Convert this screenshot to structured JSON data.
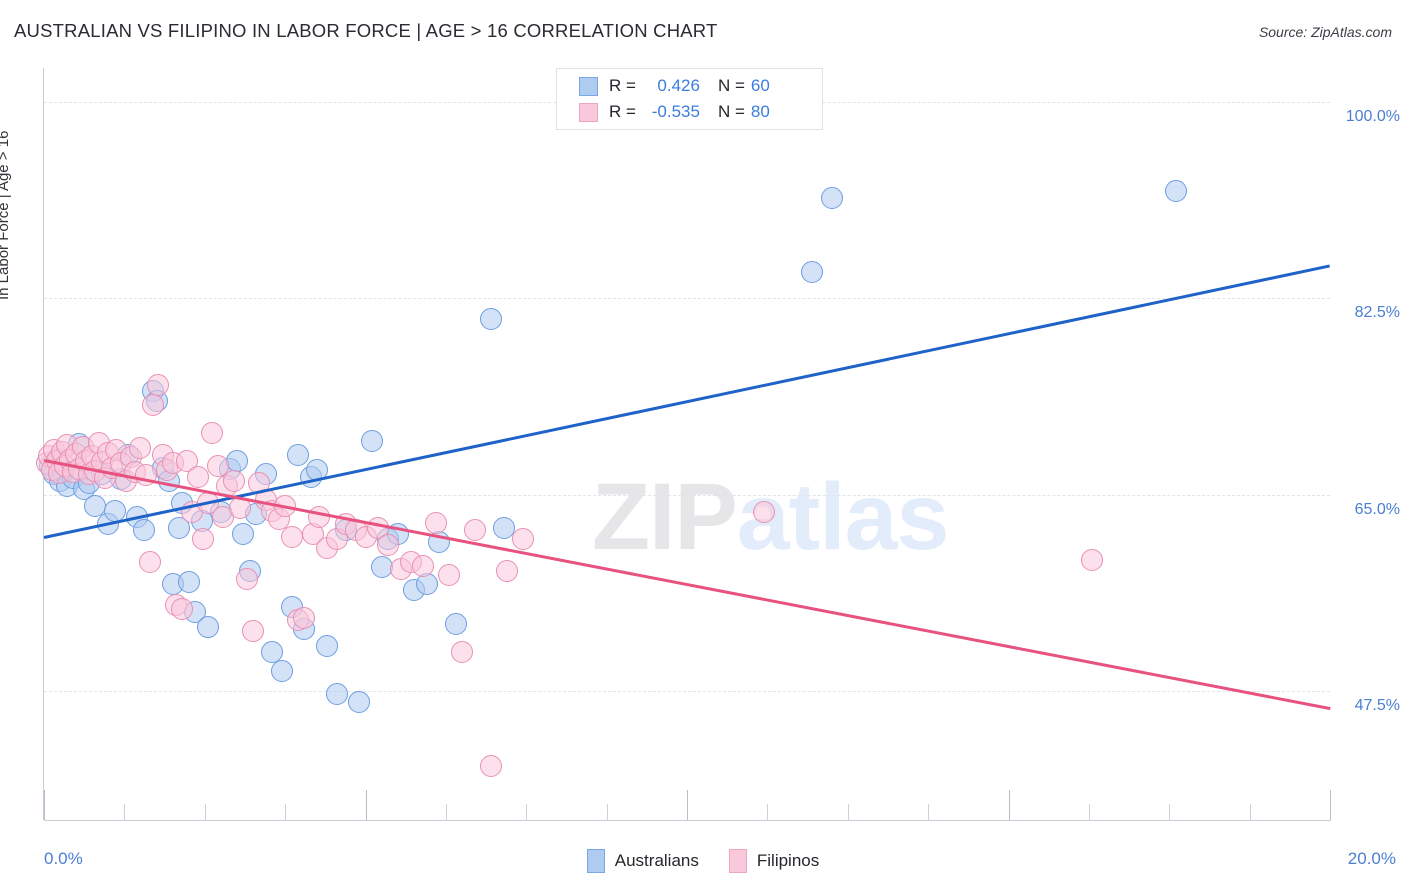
{
  "header": {
    "title": "AUSTRALIAN VS FILIPINO IN LABOR FORCE | AGE > 16 CORRELATION CHART",
    "source": "Source: ZipAtlas.com"
  },
  "watermark": {
    "zip": "ZIP",
    "atlas": "atlas"
  },
  "stats": {
    "rows": [
      {
        "series": "Australians",
        "r_label": "R =",
        "r_value": "0.426",
        "n_label": "N =",
        "n_value": "60",
        "color": "#aecbf0"
      },
      {
        "series": "Filipinos",
        "r_label": "R =",
        "r_value": "-0.535",
        "n_label": "N =",
        "n_value": "80",
        "color": "#f9c8da"
      }
    ]
  },
  "legend": {
    "items": [
      {
        "label": "Australians",
        "color": "#aecbf0",
        "border": "#7ba7e8"
      },
      {
        "label": "Filipinos",
        "color": "#f9c8da",
        "border": "#eda5c2"
      }
    ]
  },
  "chart_data": {
    "type": "scatter",
    "title": "AUSTRALIAN VS FILIPINO IN LABOR FORCE | AGE > 16 CORRELATION CHART",
    "xlabel": "",
    "ylabel": "In Labor Force | Age > 16",
    "xlim": [
      0.0,
      20.0
    ],
    "ylim": [
      36.0,
      103.0
    ],
    "x_ticklabels": [
      "0.0%",
      "20.0%"
    ],
    "y_ticklabels": [
      "100.0%",
      "82.5%",
      "65.0%",
      "47.5%"
    ],
    "y_tickvalues": [
      100.0,
      82.5,
      65.0,
      47.5
    ],
    "grid": true,
    "legend_position": "bottom",
    "series": [
      {
        "name": "Australians",
        "color": "#aecbf0",
        "border": "#6d9ee0",
        "r": 0.426,
        "n": 60,
        "trendline": {
          "x0": 0.0,
          "y0": 61.3,
          "x1": 20.0,
          "y1": 85.5,
          "color": "#1f62c8"
        },
        "points": [
          [
            0.1,
            67.5
          ],
          [
            0.15,
            66.8
          ],
          [
            0.2,
            68.2
          ],
          [
            0.25,
            66.2
          ],
          [
            0.3,
            67.0
          ],
          [
            0.35,
            65.8
          ],
          [
            0.45,
            66.5
          ],
          [
            0.55,
            69.5
          ],
          [
            0.62,
            65.5
          ],
          [
            0.7,
            66.0
          ],
          [
            0.8,
            64.0
          ],
          [
            0.9,
            66.8
          ],
          [
            1.0,
            62.4
          ],
          [
            1.1,
            63.5
          ],
          [
            1.2,
            66.4
          ],
          [
            1.3,
            68.5
          ],
          [
            1.45,
            63.0
          ],
          [
            1.55,
            61.8
          ],
          [
            1.7,
            74.2
          ],
          [
            1.75,
            73.3
          ],
          [
            1.85,
            67.4
          ],
          [
            1.95,
            66.2
          ],
          [
            2.0,
            57.0
          ],
          [
            2.1,
            62.0
          ],
          [
            2.15,
            64.2
          ],
          [
            2.25,
            57.2
          ],
          [
            2.35,
            54.5
          ],
          [
            2.45,
            62.6
          ],
          [
            2.55,
            53.2
          ],
          [
            2.75,
            63.4
          ],
          [
            2.9,
            67.3
          ],
          [
            3.0,
            68.0
          ],
          [
            3.1,
            61.5
          ],
          [
            3.2,
            58.2
          ],
          [
            3.3,
            63.3
          ],
          [
            3.45,
            66.8
          ],
          [
            3.55,
            51.0
          ],
          [
            3.7,
            49.3
          ],
          [
            3.85,
            55.0
          ],
          [
            3.95,
            68.5
          ],
          [
            4.05,
            53.0
          ],
          [
            4.15,
            66.6
          ],
          [
            4.25,
            67.2
          ],
          [
            4.4,
            51.5
          ],
          [
            4.55,
            47.2
          ],
          [
            4.7,
            61.8
          ],
          [
            4.9,
            46.5
          ],
          [
            5.1,
            69.8
          ],
          [
            5.25,
            58.5
          ],
          [
            5.35,
            61.0
          ],
          [
            5.5,
            61.5
          ],
          [
            5.75,
            56.5
          ],
          [
            5.95,
            57.0
          ],
          [
            6.15,
            60.8
          ],
          [
            6.4,
            53.5
          ],
          [
            6.95,
            80.6
          ],
          [
            7.15,
            62.0
          ],
          [
            11.95,
            84.8
          ],
          [
            12.25,
            91.4
          ],
          [
            17.6,
            92.0
          ]
        ]
      },
      {
        "name": "Filipinos",
        "color": "#f9c8da",
        "border": "#e890b4",
        "r": -0.535,
        "n": 80,
        "trendline": {
          "x0": 0.0,
          "y0": 68.2,
          "x1": 20.0,
          "y1": 46.1,
          "color": "#e8527f"
        },
        "points": [
          [
            0.05,
            67.8
          ],
          [
            0.08,
            68.4
          ],
          [
            0.12,
            67.2
          ],
          [
            0.16,
            69.0
          ],
          [
            0.2,
            68.0
          ],
          [
            0.24,
            66.9
          ],
          [
            0.28,
            68.8
          ],
          [
            0.32,
            67.5
          ],
          [
            0.36,
            69.4
          ],
          [
            0.4,
            68.1
          ],
          [
            0.45,
            67.0
          ],
          [
            0.5,
            68.6
          ],
          [
            0.55,
            67.3
          ],
          [
            0.6,
            69.2
          ],
          [
            0.65,
            68.0
          ],
          [
            0.7,
            66.8
          ],
          [
            0.75,
            68.4
          ],
          [
            0.8,
            67.1
          ],
          [
            0.85,
            69.6
          ],
          [
            0.9,
            67.9
          ],
          [
            0.95,
            66.5
          ],
          [
            1.0,
            68.7
          ],
          [
            1.05,
            67.4
          ],
          [
            1.12,
            69.0
          ],
          [
            1.2,
            67.8
          ],
          [
            1.28,
            66.2
          ],
          [
            1.35,
            68.3
          ],
          [
            1.42,
            67.0
          ],
          [
            1.5,
            69.1
          ],
          [
            1.58,
            66.7
          ],
          [
            1.65,
            59.0
          ],
          [
            1.7,
            73.0
          ],
          [
            1.78,
            74.8
          ],
          [
            1.85,
            68.5
          ],
          [
            1.92,
            67.2
          ],
          [
            2.0,
            67.8
          ],
          [
            2.05,
            55.2
          ],
          [
            2.15,
            54.8
          ],
          [
            2.22,
            68.0
          ],
          [
            2.3,
            63.4
          ],
          [
            2.4,
            66.6
          ],
          [
            2.48,
            61.0
          ],
          [
            2.55,
            64.2
          ],
          [
            2.62,
            70.5
          ],
          [
            2.7,
            67.5
          ],
          [
            2.78,
            63.0
          ],
          [
            2.85,
            65.8
          ],
          [
            2.95,
            66.2
          ],
          [
            3.05,
            63.8
          ],
          [
            3.15,
            57.5
          ],
          [
            3.25,
            52.8
          ],
          [
            3.35,
            66.0
          ],
          [
            3.45,
            64.5
          ],
          [
            3.55,
            63.5
          ],
          [
            3.65,
            62.8
          ],
          [
            3.75,
            64.0
          ],
          [
            3.85,
            61.2
          ],
          [
            3.95,
            53.8
          ],
          [
            4.05,
            54.0
          ],
          [
            4.18,
            61.5
          ],
          [
            4.28,
            63.0
          ],
          [
            4.4,
            60.2
          ],
          [
            4.55,
            61.0
          ],
          [
            4.7,
            62.4
          ],
          [
            4.85,
            61.8
          ],
          [
            5.0,
            61.2
          ],
          [
            5.2,
            62.0
          ],
          [
            5.35,
            60.5
          ],
          [
            5.55,
            58.4
          ],
          [
            5.7,
            59.0
          ],
          [
            5.9,
            58.6
          ],
          [
            6.1,
            62.5
          ],
          [
            6.3,
            57.8
          ],
          [
            6.5,
            51.0
          ],
          [
            6.7,
            61.8
          ],
          [
            6.95,
            40.8
          ],
          [
            7.2,
            58.2
          ],
          [
            7.45,
            61.0
          ],
          [
            11.2,
            63.4
          ],
          [
            16.3,
            59.2
          ]
        ]
      }
    ]
  },
  "axis": {
    "y_title": "In Labor Force | Age > 16",
    "x_min_label": "0.0%",
    "x_max_label": "20.0%"
  }
}
